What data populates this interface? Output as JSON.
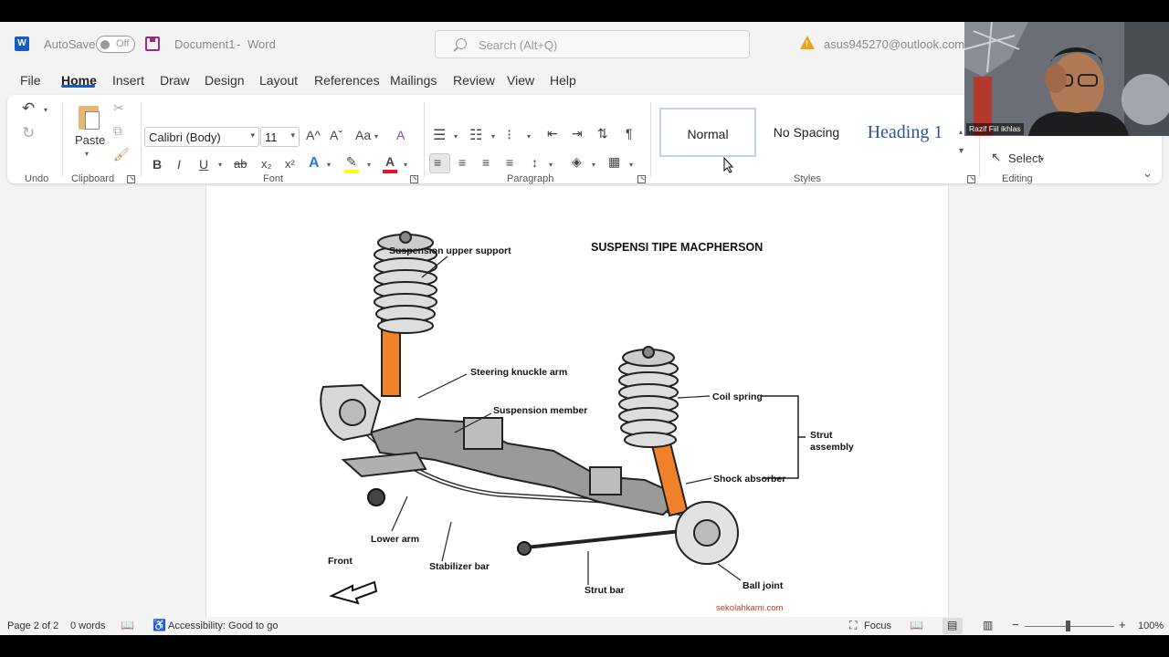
{
  "titlebar": {
    "app_icon": "W",
    "autosave_label": "AutoSave",
    "autosave_state": "Off",
    "doc_title": "Document1",
    "separator": "-",
    "app_name": "Word",
    "search_placeholder": "Search (Alt+Q)",
    "account": "asus945270@outlook.com"
  },
  "tabs": [
    "File",
    "Home",
    "Insert",
    "Draw",
    "Design",
    "Layout",
    "References",
    "Mailings",
    "Review",
    "View",
    "Help"
  ],
  "active_tab": "Home",
  "ribbon": {
    "undo": {
      "label": "Undo"
    },
    "clipboard": {
      "label": "Clipboard",
      "paste_label": "Paste"
    },
    "font": {
      "label": "Font",
      "font_name": "Calibri (Body)",
      "font_size": "11",
      "grow": "A^",
      "shrink": "Aˇ",
      "case": "Aa",
      "bold": "B",
      "italic": "I",
      "underline": "U",
      "strike": "ab",
      "sub": "x₂",
      "sup": "x²",
      "effects": "A",
      "highlight": "✎",
      "color": "A",
      "highlight_color": "#ffff00",
      "font_color": "#e81123"
    },
    "paragraph": {
      "label": "Paragraph"
    },
    "styles": {
      "label": "Styles",
      "items": [
        "Normal",
        "No Spacing",
        "Heading 1"
      ]
    },
    "editing": {
      "label": "Editing",
      "select_label": "Select"
    }
  },
  "webcam": {
    "name": "Razif Fiil ikhlas"
  },
  "document": {
    "title": "SUSPENSI TIPE MACPHERSON",
    "labels": {
      "upper_support": "Suspension upper support",
      "knuckle": "Steering knuckle arm",
      "member": "Suspension member",
      "coil": "Coil spring",
      "strut1": "Strut",
      "strut2": "assembly",
      "shock": "Shock absorber",
      "lower_arm": "Lower arm",
      "front": "Front",
      "stabilizer": "Stabilizer bar",
      "strut_bar": "Strut bar",
      "ball_joint": "Ball joint",
      "watermark": "sekolahkami.com"
    }
  },
  "status": {
    "page": "Page 2 of 2",
    "words": "0 words",
    "accessibility": "Accessibility: Good to go",
    "focus": "Focus",
    "zoom": "100%"
  }
}
